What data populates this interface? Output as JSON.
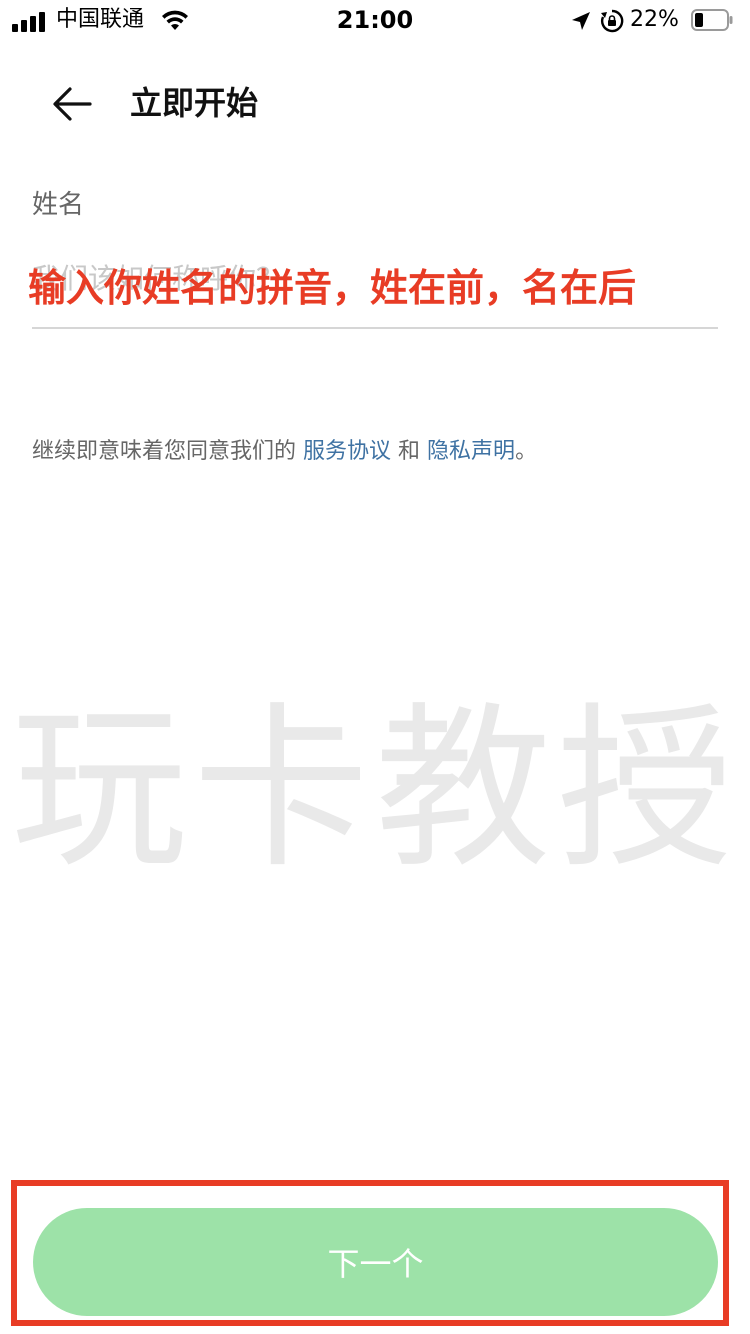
{
  "status_bar": {
    "carrier": "中国联通",
    "time": "21:00",
    "battery": "22%"
  },
  "header": {
    "title": "立即开始"
  },
  "form": {
    "name_label": "姓名",
    "name_placeholder": "我们该如何称呼你？",
    "name_value": ""
  },
  "annotation": {
    "text": "输入你姓名的拼音，姓在前，名在后"
  },
  "agreement": {
    "prefix": "继续即意味着您同意我们的",
    "terms_link": "服务协议",
    "conjunction": "和",
    "privacy_link": "隐私声明",
    "suffix": "。"
  },
  "watermark": {
    "text": "玩卡教授"
  },
  "footer": {
    "next_label": "下一个"
  },
  "colors": {
    "accent_link": "#3f72a3",
    "button_bg": "#9de2a8",
    "annotation_red": "#e83c25"
  },
  "icons": {
    "back": "arrow-left-icon",
    "wifi": "wifi-icon",
    "signal": "cellular-signal-icon",
    "location": "location-arrow-icon",
    "rotation_lock": "rotation-lock-icon",
    "battery": "battery-icon"
  }
}
